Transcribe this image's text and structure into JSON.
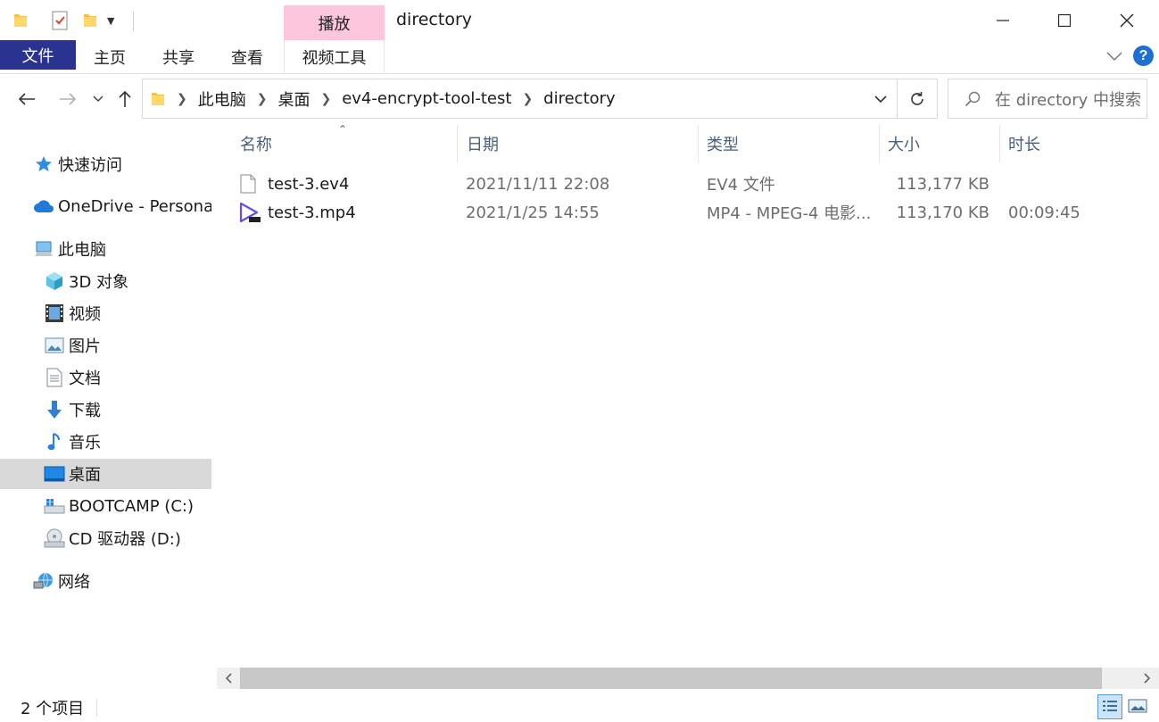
{
  "window": {
    "title": "directory",
    "context_tab_label": "播放",
    "colors": {
      "file_tab_bg": "#2b3390",
      "context_tab_bg": "#fcc6dd",
      "help_blue": "#1e6fd0"
    }
  },
  "ribbon": {
    "tabs": [
      {
        "label": "文件"
      },
      {
        "label": "主页"
      },
      {
        "label": "共享"
      },
      {
        "label": "查看"
      },
      {
        "label": "视频工具"
      }
    ]
  },
  "breadcrumb": {
    "items": [
      {
        "label": "此电脑"
      },
      {
        "label": "桌面"
      },
      {
        "label": "ev4-encrypt-tool-test"
      },
      {
        "label": "directory"
      }
    ]
  },
  "search": {
    "placeholder": "在 directory 中搜索"
  },
  "sidebar": {
    "items": [
      {
        "label": "快速访问",
        "icon": "star-icon"
      },
      {
        "label": "OneDrive - Personal",
        "icon": "cloud-icon"
      },
      {
        "label": "此电脑",
        "icon": "computer-icon"
      },
      {
        "label": "3D 对象",
        "icon": "cube-3d-icon"
      },
      {
        "label": "视频",
        "icon": "film-icon"
      },
      {
        "label": "图片",
        "icon": "picture-icon"
      },
      {
        "label": "文档",
        "icon": "document-icon"
      },
      {
        "label": "下载",
        "icon": "download-arrow-icon"
      },
      {
        "label": "音乐",
        "icon": "music-note-icon"
      },
      {
        "label": "桌面",
        "icon": "desktop-icon",
        "selected": true
      },
      {
        "label": "BOOTCAMP (C:)",
        "icon": "drive-windows-icon"
      },
      {
        "label": "CD 驱动器 (D:)",
        "icon": "cd-drive-icon"
      },
      {
        "label": "网络",
        "icon": "network-icon"
      }
    ]
  },
  "file_list": {
    "columns": [
      {
        "label": "名称"
      },
      {
        "label": "日期"
      },
      {
        "label": "类型"
      },
      {
        "label": "大小"
      },
      {
        "label": "时长"
      }
    ],
    "rows": [
      {
        "name": "test-3.ev4",
        "date": "2021/11/11 22:08",
        "type": "EV4 文件",
        "size": "113,177 KB",
        "duration": "",
        "icon": "blank-file-icon"
      },
      {
        "name": "test-3.mp4",
        "date": "2021/1/25 14:55",
        "type": "MP4 - MPEG-4 电影...",
        "size": "113,170 KB",
        "duration": "00:09:45",
        "icon": "video-play-file-icon"
      }
    ]
  },
  "status": {
    "item_count": "2 个项目"
  }
}
